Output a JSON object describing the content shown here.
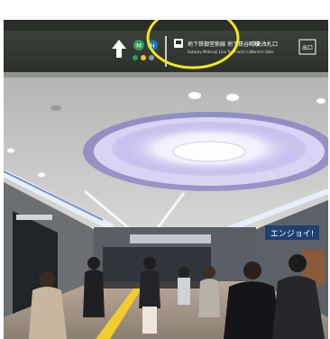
{
  "scene": "Underground station passage with overhead direction sign and circular chandelier",
  "sign": {
    "arrow": "up-arrow-icon",
    "line_badges": [
      {
        "label": "M",
        "color": "#2e9e5b"
      },
      {
        "label": "H",
        "color": "#1a73b8"
      }
    ],
    "dots": [
      "#2e9e5b",
      "#f2c12e",
      "#8e9aa6"
    ],
    "blocks": [
      {
        "line1": "地下鉄御堂筋線",
        "line2": "Subway Midosuji Line"
      },
      {
        "line1": "地下鉄谷町線",
        "line2": "Tanimachi Line"
      },
      {
        "line1": "中央改札口",
        "line2": "Central Gate"
      }
    ],
    "exit_label": "出口"
  },
  "annotation": {
    "shape": "ellipse",
    "color": "#f2e81a"
  },
  "storefront_text": "エンジョイ!"
}
